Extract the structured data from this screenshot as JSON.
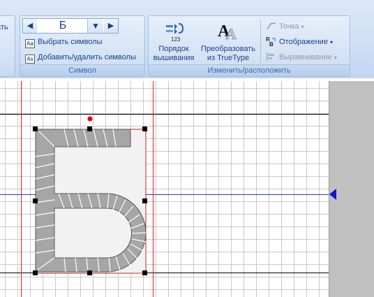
{
  "ribbon": {
    "partial_label": "ать",
    "nav": {
      "prev_icon": "◀",
      "current_symbol": "Б",
      "dropdown_icon": "▼",
      "next_icon": "▶"
    },
    "select_symbols": "Выбрать символы",
    "add_remove_symbols": "Добавить/удалить символы",
    "group_symbol_title": "Символ",
    "embroidery_order": {
      "line1": "Порядок",
      "line2": "вышивания",
      "badge": "123"
    },
    "convert_truetype": {
      "line1": "Преобразовать",
      "line2": "из TrueType",
      "glyph": "A"
    },
    "point": "Точка",
    "display": "Отображение",
    "alignment": "Выравнивание",
    "group_modify_title": "Изменить/расположить"
  },
  "colors": {
    "guide_red": "#d02020",
    "baseline_blue": "#1f3fd0",
    "stitch_fill": "#a6a6a6",
    "selection_handle": "#000000",
    "rotation_handle": "#e00000"
  }
}
